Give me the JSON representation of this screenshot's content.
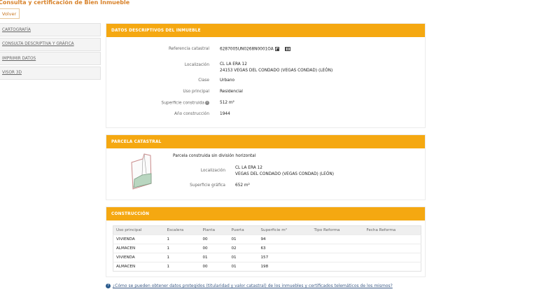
{
  "header": {
    "title": "Consulta y certificación de Bien Inmueble",
    "back_label": "Volver"
  },
  "sidebar": {
    "items": [
      {
        "label": "CARTOGRAFÍA"
      },
      {
        "label": "CONSULTA DESCRIPTIVA Y GRÁFICA"
      },
      {
        "label": "IMPRIMIR DATOS"
      },
      {
        "label": "VISOR 3D"
      }
    ]
  },
  "descriptivos": {
    "heading": "DATOS DESCRIPTIVOS DEL INMUEBLE",
    "referencia": {
      "label": "Referencia catastral",
      "value": "6287005UN0268N0001OA"
    },
    "localizacion": {
      "label": "Localización",
      "line1": "CL LA ERA 12",
      "line2": "24153 VEGAS DEL CONDADO (VEGAS CONDAD) (LEÓN)"
    },
    "clase": {
      "label": "Clase",
      "value": "Urbano"
    },
    "uso": {
      "label": "Uso principal",
      "value": "Residencial"
    },
    "superficie": {
      "label": "Superficie construida",
      "value": "512 m²"
    },
    "anio": {
      "label": "Año construcción",
      "value": "1944"
    }
  },
  "parcela": {
    "heading": "PARCELA CATASTRAL",
    "subtitle": "Parcela construida sin división horizontal",
    "localizacion": {
      "label": "Localización",
      "line1": "CL LA ERA 12",
      "line2": "VEGAS DEL CONDADO (VEGAS CONDAD) (LEÓN)"
    },
    "superficie": {
      "label": "Superficie gráfica",
      "value": "652 m²"
    }
  },
  "construccion": {
    "heading": "CONSTRUCCIÓN",
    "columns": [
      "Uso principal",
      "Escalera",
      "Planta",
      "Puerta",
      "Superficie m²",
      "Tipo Reforma",
      "Fecha Reforma"
    ],
    "rows": [
      [
        "VIVIENDA",
        "1",
        "00",
        "01",
        "94",
        "",
        ""
      ],
      [
        "ALMACEN",
        "1",
        "00",
        "02",
        "63",
        "",
        ""
      ],
      [
        "VIVIENDA",
        "1",
        "01",
        "01",
        "157",
        "",
        ""
      ],
      [
        "ALMACEN",
        "1",
        "00",
        "01",
        "198",
        "",
        ""
      ]
    ]
  },
  "footer": {
    "faq_link": "¿Cómo se pueden obtener datos protegidos (titularidad y valor catastral) de los inmuebles y certificados telemáticos de los mismos?"
  },
  "colors": {
    "accent": "#f5a811",
    "title": "#d8822a",
    "link": "#3b5a86"
  }
}
